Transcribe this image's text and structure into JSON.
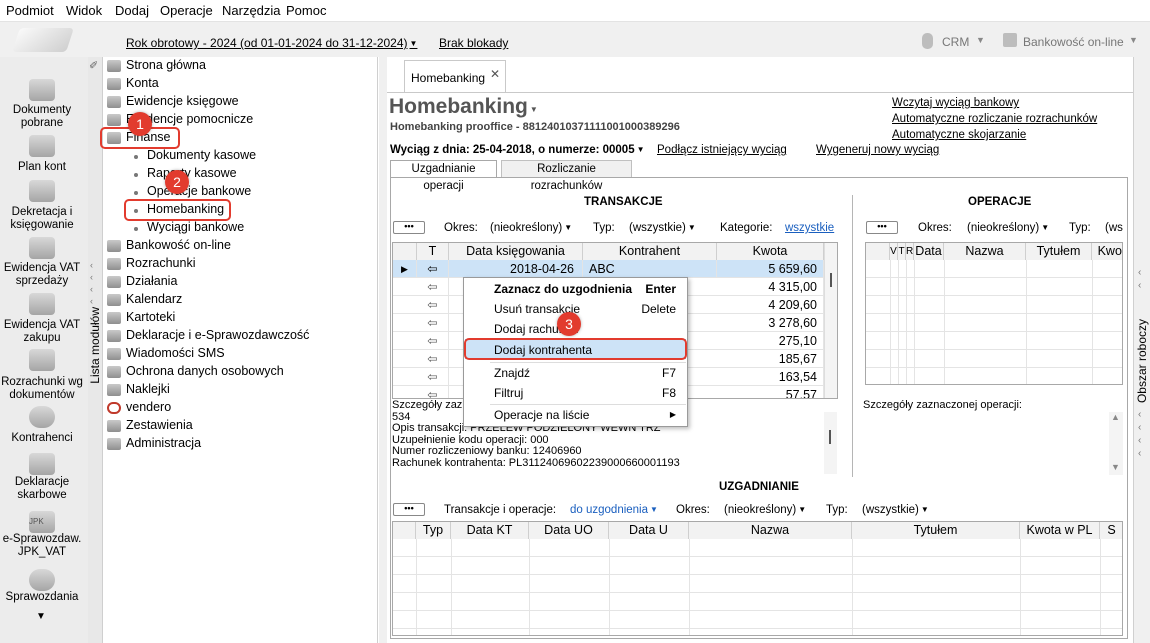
{
  "menubar": [
    "Podmiot",
    "Widok",
    "Dodaj",
    "Operacje",
    "Narzędzia",
    "Pomoc"
  ],
  "toolbar": {
    "year": "Rok obrotowy - 2024  (od 01-01-2024 do 31-12-2024)",
    "lock": "Brak blokady",
    "crm": "CRM",
    "bank_online": "Bankowość on-line"
  },
  "leftbar": [
    "Dokumenty pobrane",
    "Plan kont",
    "Dekretacja i księgowanie",
    "Ewidencja VAT sprzedaży",
    "Ewidencja VAT zakupu",
    "Rozrachunki wg dokumentów",
    "Kontrahenci",
    "Deklaracje skarbowe",
    "e-Sprawozdaw. JPK_VAT",
    "Sprawozdania"
  ],
  "leftbar_icons": {
    "jpk": "JPK"
  },
  "modstrip_label": "Lista modułów",
  "tree": {
    "top": [
      "Strona główna",
      "Konta",
      "Ewidencje księgowe",
      "Ewidencje pomocnicze",
      "Finanse"
    ],
    "finanse_children": [
      "Dokumenty kasowe",
      "Raporty kasowe",
      "Operacje bankowe",
      "Homebanking",
      "Wyciągi bankowe"
    ],
    "rest": [
      "Bankowość on-line",
      "Rozrachunki",
      "Działania",
      "Kalendarz",
      "Kartoteki",
      "Deklaracje i e-Sprawozdawczość",
      "Wiadomości SMS",
      "Ochrona danych osobowych",
      "Naklejki",
      "vendero",
      "Zestawienia",
      "Administracja"
    ]
  },
  "badges": [
    "1",
    "2",
    "3"
  ],
  "tab": "Homebanking",
  "header": {
    "title": "Homebanking",
    "subtitle": "Homebanking prooffice - 88124010371111001000389296",
    "links": [
      "Wczytaj wyciąg bankowy",
      "Automatyczne rozliczanie rozrachunków",
      "Automatyczne skojarzanie"
    ]
  },
  "statement": {
    "label": "Wyciąg z dnia: 25-04-2018, o numerze: 00005",
    "attach": "Podłącz istniejący wyciąg",
    "generate": "Wygeneruj nowy wyciąg"
  },
  "subtabs": [
    "Uzgadnianie operacji",
    "Rozliczanie rozrachunków"
  ],
  "transakcje": {
    "title": "TRANSAKCJE",
    "filters": {
      "okres_label": "Okres:",
      "okres_value": "(nieokreślony)",
      "typ_label": "Typ:",
      "typ_value": "(wszystkie)",
      "kat_label": "Kategorie:",
      "kat_value": "wszystkie"
    },
    "columns": [
      "T",
      "Data księgowania",
      "Kontrahent",
      "Kwota"
    ],
    "rows": [
      {
        "arrow": "⇦",
        "date": "2018-04-26",
        "contractor": "ABC",
        "amount": "5 659,60"
      },
      {
        "arrow": "⇦",
        "date": "",
        "contractor": "",
        "amount": "4 315,00"
      },
      {
        "arrow": "⇦",
        "date": "",
        "contractor": "",
        "amount": "4 209,60"
      },
      {
        "arrow": "⇦",
        "date": "",
        "contractor": "",
        "amount": "3 278,60"
      },
      {
        "arrow": "⇦",
        "date": "",
        "contractor": "",
        "amount": "275,10"
      },
      {
        "arrow": "⇦",
        "date": "",
        "contractor": "",
        "amount": "185,67"
      },
      {
        "arrow": "⇦",
        "date": "",
        "contractor": "",
        "amount": "163,54"
      },
      {
        "arrow": "⇦",
        "date": "",
        "contractor": "",
        "amount": "57,57"
      }
    ],
    "details": [
      "Szczegóły zazn",
      "534",
      "Opis transakcji: PRZELEW PODZIELONY WEWN TRZ",
      "Uzupełnienie kodu operacji: 000",
      "Numer rozliczeniowy banku: 12406960",
      "Rachunek kontrahenta: PL31124069602239000660001193"
    ]
  },
  "operacje": {
    "title": "OPERACJE",
    "filters": {
      "okres_label": "Okres:",
      "okres_value": "(nieokreślony)",
      "typ_label": "Typ:",
      "typ_value": "(ws"
    },
    "columns": [
      "V",
      "T",
      "R",
      "Data",
      "Nazwa",
      "Tytułem",
      "Kwot"
    ],
    "details": "Szczegóły zaznaczonej operacji:"
  },
  "uzgadnianie": {
    "title": "UZGADNIANIE",
    "filters": {
      "tr_label": "Transakcje i operacje:",
      "tr_value": "do uzgodnienia",
      "okres_label": "Okres:",
      "okres_value": "(nieokreślony)",
      "typ_label": "Typ:",
      "typ_value": "(wszystkie)"
    },
    "columns": [
      "Typ",
      "Data KT",
      "Data UO",
      "Data U",
      "Nazwa",
      "Tytułem",
      "Kwota w PL",
      "S"
    ]
  },
  "context_menu": [
    {
      "label": "Zaznacz do uzgodnienia",
      "shortcut": "Enter",
      "bold": true
    },
    {
      "label": "Usuń transakcje",
      "shortcut": "Delete"
    },
    {
      "label": "Dodaj rachunek",
      "shortcut": ""
    },
    {
      "label": "Dodaj kontrahenta",
      "shortcut": ""
    },
    {
      "label": "Znajdź",
      "shortcut": "F7"
    },
    {
      "label": "Filtruj",
      "shortcut": "F8"
    },
    {
      "label": "Operacje na liście",
      "shortcut": "▶"
    }
  ],
  "right_label": "Obszar roboczy",
  "colors": {
    "accent": "#e23b2e",
    "selected_row": "#cde3f7",
    "link": "#1a5fbf"
  }
}
